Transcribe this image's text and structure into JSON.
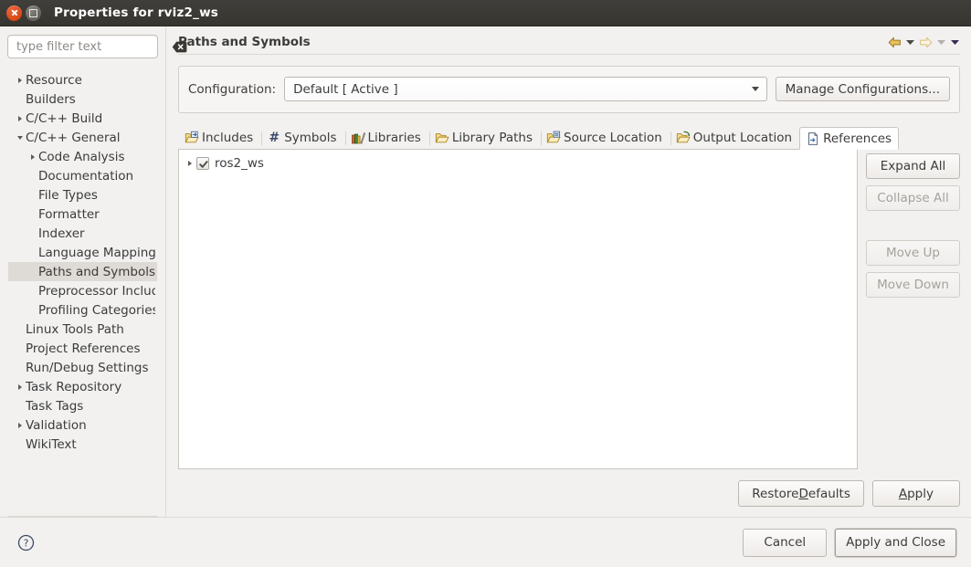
{
  "window": {
    "title": "Properties for rviz2_ws",
    "close_icon": "close-icon",
    "maximize_icon": "maximize-icon"
  },
  "filter": {
    "placeholder": "type filter text",
    "value": "",
    "clear_icon": "clear-icon"
  },
  "sidebar": {
    "items": [
      {
        "label": "Resource",
        "indent": 0,
        "twisty": "collapsed",
        "selected": false
      },
      {
        "label": "Builders",
        "indent": 0,
        "twisty": "none",
        "selected": false
      },
      {
        "label": "C/C++ Build",
        "indent": 0,
        "twisty": "collapsed",
        "selected": false
      },
      {
        "label": "C/C++ General",
        "indent": 0,
        "twisty": "expanded",
        "selected": false
      },
      {
        "label": "Code Analysis",
        "indent": 1,
        "twisty": "collapsed",
        "selected": false
      },
      {
        "label": "Documentation",
        "indent": 1,
        "twisty": "none",
        "selected": false
      },
      {
        "label": "File Types",
        "indent": 1,
        "twisty": "none",
        "selected": false
      },
      {
        "label": "Formatter",
        "indent": 1,
        "twisty": "none",
        "selected": false
      },
      {
        "label": "Indexer",
        "indent": 1,
        "twisty": "none",
        "selected": false
      },
      {
        "label": "Language Mappings",
        "indent": 1,
        "twisty": "none",
        "selected": false
      },
      {
        "label": "Paths and Symbols",
        "indent": 1,
        "twisty": "none",
        "selected": true
      },
      {
        "label": "Preprocessor Include",
        "indent": 1,
        "twisty": "none",
        "selected": false
      },
      {
        "label": "Profiling Categories",
        "indent": 1,
        "twisty": "none",
        "selected": false
      },
      {
        "label": "Linux Tools Path",
        "indent": 0,
        "twisty": "none",
        "selected": false
      },
      {
        "label": "Project References",
        "indent": 0,
        "twisty": "none",
        "selected": false
      },
      {
        "label": "Run/Debug Settings",
        "indent": 0,
        "twisty": "none",
        "selected": false
      },
      {
        "label": "Task Repository",
        "indent": 0,
        "twisty": "collapsed",
        "selected": false
      },
      {
        "label": "Task Tags",
        "indent": 0,
        "twisty": "none",
        "selected": false
      },
      {
        "label": "Validation",
        "indent": 0,
        "twisty": "collapsed",
        "selected": false
      },
      {
        "label": "WikiText",
        "indent": 0,
        "twisty": "none",
        "selected": false
      }
    ]
  },
  "page": {
    "title": "Paths and Symbols",
    "nav": {
      "back_icon": "back-arrow-icon",
      "back_menu_icon": "dropdown-arrow-icon",
      "forward_icon": "forward-arrow-icon",
      "forward_menu_icon": "dropdown-arrow-icon",
      "view_menu_icon": "dropdown-arrow-icon"
    }
  },
  "configuration": {
    "label": "Configuration:",
    "selected": "Default  [ Active ]",
    "manage_button": "Manage Configurations..."
  },
  "tabs": [
    {
      "label": "Includes",
      "icon": "includes-folder-icon",
      "active": false
    },
    {
      "label": "Symbols",
      "icon": "hash-symbol-icon",
      "active": false
    },
    {
      "label": "Libraries",
      "icon": "libraries-books-icon",
      "active": false
    },
    {
      "label": "Library Paths",
      "icon": "library-paths-folder-icon",
      "active": false
    },
    {
      "label": "Source Location",
      "icon": "source-folder-icon",
      "active": false
    },
    {
      "label": "Output Location",
      "icon": "output-folder-icon",
      "active": false
    },
    {
      "label": "References",
      "icon": "references-document-icon",
      "active": true
    }
  ],
  "references_tree": {
    "rows": [
      {
        "label": "ros2_ws",
        "checked": true,
        "twisty": "collapsed"
      }
    ]
  },
  "side_buttons": [
    {
      "label": "Expand All",
      "enabled": true,
      "gap_before": false
    },
    {
      "label": "Collapse All",
      "enabled": false,
      "gap_before": false
    },
    {
      "label": "Move Up",
      "enabled": false,
      "gap_before": true
    },
    {
      "label": "Move Down",
      "enabled": false,
      "gap_before": false
    }
  ],
  "bottom_buttons": {
    "restore_defaults": {
      "before": "Restore ",
      "mnemonic": "D",
      "after": "efaults"
    },
    "apply": {
      "before": "",
      "mnemonic": "A",
      "after": "pply"
    }
  },
  "footer": {
    "help_icon": "help-question-icon",
    "cancel": "Cancel",
    "apply_and_close": "Apply and Close"
  },
  "colors": {
    "titlebar": "#3a3833",
    "close_button": "#dd4814",
    "accent_gold": "#e8b84b",
    "selection": "#dedad5",
    "panel_white": "#ffffff",
    "dialog_bg": "#f2f1f0"
  }
}
